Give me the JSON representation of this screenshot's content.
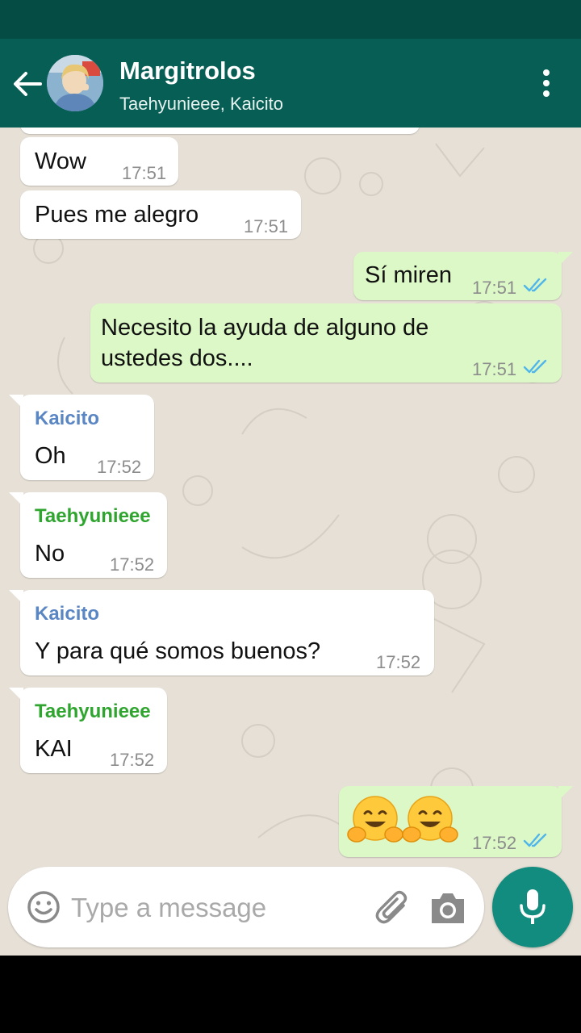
{
  "header": {
    "title": "Margitrolos",
    "subtitle": "Taehyunieee, Kaicito"
  },
  "colors": {
    "header": "#075E54",
    "status_bar": "#054D44",
    "outgoing_bubble": "#DCF8C6",
    "incoming_bubble": "#FFFFFF",
    "chat_background": "#E6E0D6",
    "kaicito_name": "#5A86C4",
    "taehyunieee_name": "#2FA52F",
    "read_ticks": "#4FB6EC",
    "mic_button": "#128C7E"
  },
  "messages": [
    {
      "direction": "in",
      "text": "Wow",
      "time": "17:51"
    },
    {
      "direction": "in",
      "text": "Pues me alegro",
      "time": "17:51"
    },
    {
      "direction": "out",
      "text": "Sí miren",
      "time": "17:51",
      "status": "read"
    },
    {
      "direction": "out",
      "text_lines": [
        "Necesito la ayuda de alguno de",
        "ustedes dos...."
      ],
      "time": "17:51",
      "status": "read"
    },
    {
      "direction": "in",
      "sender": "Kaicito",
      "text": "Oh",
      "time": "17:52"
    },
    {
      "direction": "in",
      "sender": "Taehyunieee",
      "text": "No",
      "time": "17:52"
    },
    {
      "direction": "in",
      "sender": "Kaicito",
      "text": "Y para qué somos buenos?",
      "time": "17:52"
    },
    {
      "direction": "in",
      "sender": "Taehyunieee",
      "text": "KAI",
      "time": "17:52"
    },
    {
      "direction": "out",
      "emoji": "hugging-face-icon x2",
      "time": "17:52",
      "status": "read"
    }
  ],
  "composer": {
    "placeholder": "Type a message"
  },
  "icons": [
    "back-arrow-icon",
    "more-vert-icon",
    "emoji-icon",
    "paperclip-icon",
    "camera-icon",
    "mic-icon",
    "double-check-icon",
    "hugging-face-icon"
  ]
}
